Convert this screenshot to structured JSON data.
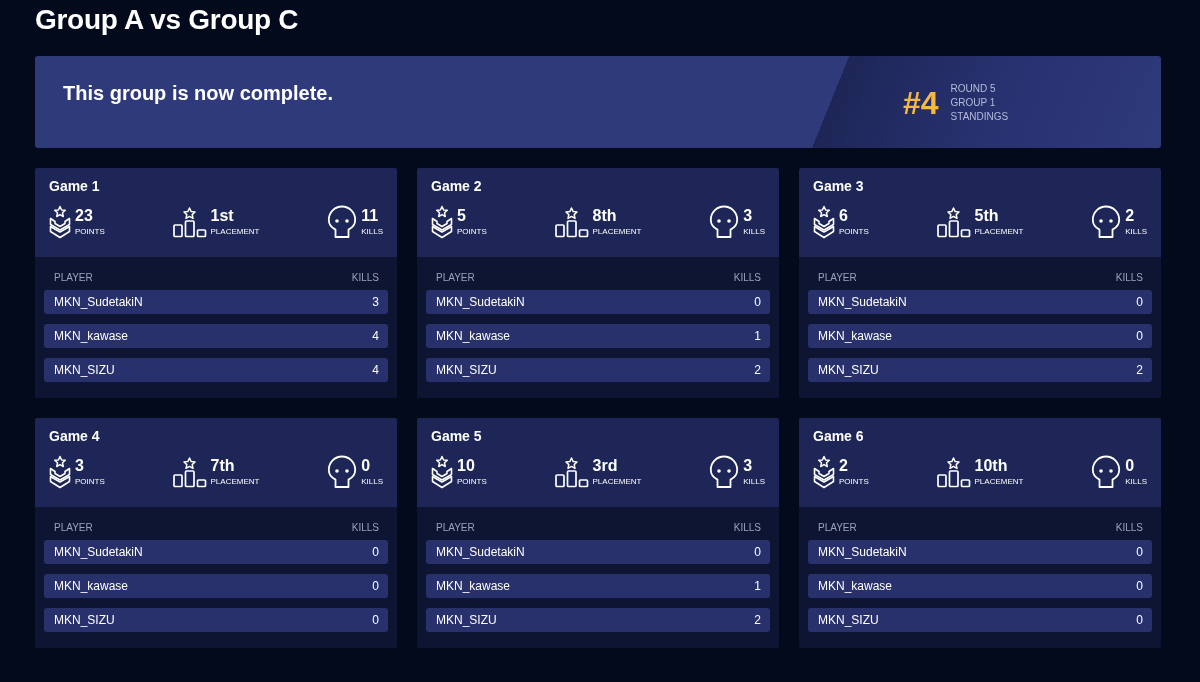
{
  "page": {
    "title": "Group A vs Group C"
  },
  "banner": {
    "message": "This group is now complete.",
    "rank": "#4",
    "rank_lines": [
      "ROUND 5",
      "GROUP 1",
      "STANDINGS"
    ]
  },
  "games": [
    {
      "title": "Game 1",
      "stats": [
        {
          "kind": "points",
          "value": "23",
          "label": "POINTS"
        },
        {
          "kind": "placement",
          "value": "1st",
          "label": "PLACEMENT"
        },
        {
          "kind": "kills",
          "value": "11",
          "label": "KILLS"
        }
      ],
      "columns": [
        "PLAYER",
        "KILLS"
      ],
      "players": [
        {
          "name": "MKN_SudetakiN",
          "kills": "3"
        },
        {
          "name": "MKN_kawase",
          "kills": "4"
        },
        {
          "name": "MKN_SIZU",
          "kills": "4"
        }
      ]
    },
    {
      "title": "Game 2",
      "stats": [
        {
          "kind": "points",
          "value": "5",
          "label": "POINTS"
        },
        {
          "kind": "placement",
          "value": "8th",
          "label": "PLACEMENT"
        },
        {
          "kind": "kills",
          "value": "3",
          "label": "KILLS"
        }
      ],
      "columns": [
        "PLAYER",
        "KILLS"
      ],
      "players": [
        {
          "name": "MKN_SudetakiN",
          "kills": "0"
        },
        {
          "name": "MKN_kawase",
          "kills": "1"
        },
        {
          "name": "MKN_SIZU",
          "kills": "2"
        }
      ]
    },
    {
      "title": "Game 3",
      "stats": [
        {
          "kind": "points",
          "value": "6",
          "label": "POINTS"
        },
        {
          "kind": "placement",
          "value": "5th",
          "label": "PLACEMENT"
        },
        {
          "kind": "kills",
          "value": "2",
          "label": "KILLS"
        }
      ],
      "columns": [
        "PLAYER",
        "KILLS"
      ],
      "players": [
        {
          "name": "MKN_SudetakiN",
          "kills": "0"
        },
        {
          "name": "MKN_kawase",
          "kills": "0"
        },
        {
          "name": "MKN_SIZU",
          "kills": "2"
        }
      ]
    },
    {
      "title": "Game 4",
      "stats": [
        {
          "kind": "points",
          "value": "3",
          "label": "POINTS"
        },
        {
          "kind": "placement",
          "value": "7th",
          "label": "PLACEMENT"
        },
        {
          "kind": "kills",
          "value": "0",
          "label": "KILLS"
        }
      ],
      "columns": [
        "PLAYER",
        "KILLS"
      ],
      "players": [
        {
          "name": "MKN_SudetakiN",
          "kills": "0"
        },
        {
          "name": "MKN_kawase",
          "kills": "0"
        },
        {
          "name": "MKN_SIZU",
          "kills": "0"
        }
      ]
    },
    {
      "title": "Game 5",
      "stats": [
        {
          "kind": "points",
          "value": "10",
          "label": "POINTS"
        },
        {
          "kind": "placement",
          "value": "3rd",
          "label": "PLACEMENT"
        },
        {
          "kind": "kills",
          "value": "3",
          "label": "KILLS"
        }
      ],
      "columns": [
        "PLAYER",
        "KILLS"
      ],
      "players": [
        {
          "name": "MKN_SudetakiN",
          "kills": "0"
        },
        {
          "name": "MKN_kawase",
          "kills": "1"
        },
        {
          "name": "MKN_SIZU",
          "kills": "2"
        }
      ]
    },
    {
      "title": "Game 6",
      "stats": [
        {
          "kind": "points",
          "value": "2",
          "label": "POINTS"
        },
        {
          "kind": "placement",
          "value": "10th",
          "label": "PLACEMENT"
        },
        {
          "kind": "kills",
          "value": "0",
          "label": "KILLS"
        }
      ],
      "columns": [
        "PLAYER",
        "KILLS"
      ],
      "players": [
        {
          "name": "MKN_SudetakiN",
          "kills": "0"
        },
        {
          "name": "MKN_kawase",
          "kills": "0"
        },
        {
          "name": "MKN_SIZU",
          "kills": "0"
        }
      ]
    }
  ]
}
